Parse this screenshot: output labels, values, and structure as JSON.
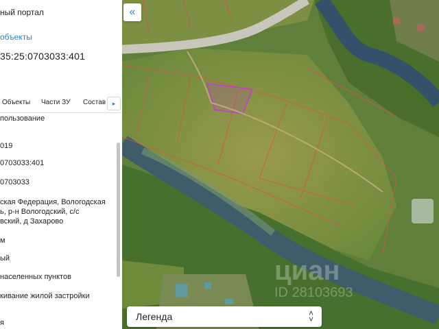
{
  "panel": {
    "portal_title": "ный портал",
    "objects_link": "объекты",
    "cadastral_number": "35:25:0703033:401",
    "tabs": [
      "Объекты",
      "Части ЗУ",
      "Состав"
    ],
    "tabs_more_icon": "chevron-right-icon",
    "fields": [
      "пользование",
      "019",
      "0703033:401",
      "0703033",
      "ская Федерация, Вологодская",
      "ь, р-н Вологодский, с/с",
      "вский, д Захарово",
      "м",
      "ый",
      "населенных пунктов",
      "кивание жилой застройки",
      "я"
    ]
  },
  "map": {
    "collapse_icon": "double-chevron-left-icon",
    "legend_label": "Легенда",
    "legend_icon": "chevron-up-down-icon",
    "watermark": "циан",
    "watermark_id": "ID 28103693"
  },
  "colors": {
    "accent": "#2d7fd3",
    "parcel_border": "#d9534f",
    "selected_parcel": "#c23bd4"
  }
}
